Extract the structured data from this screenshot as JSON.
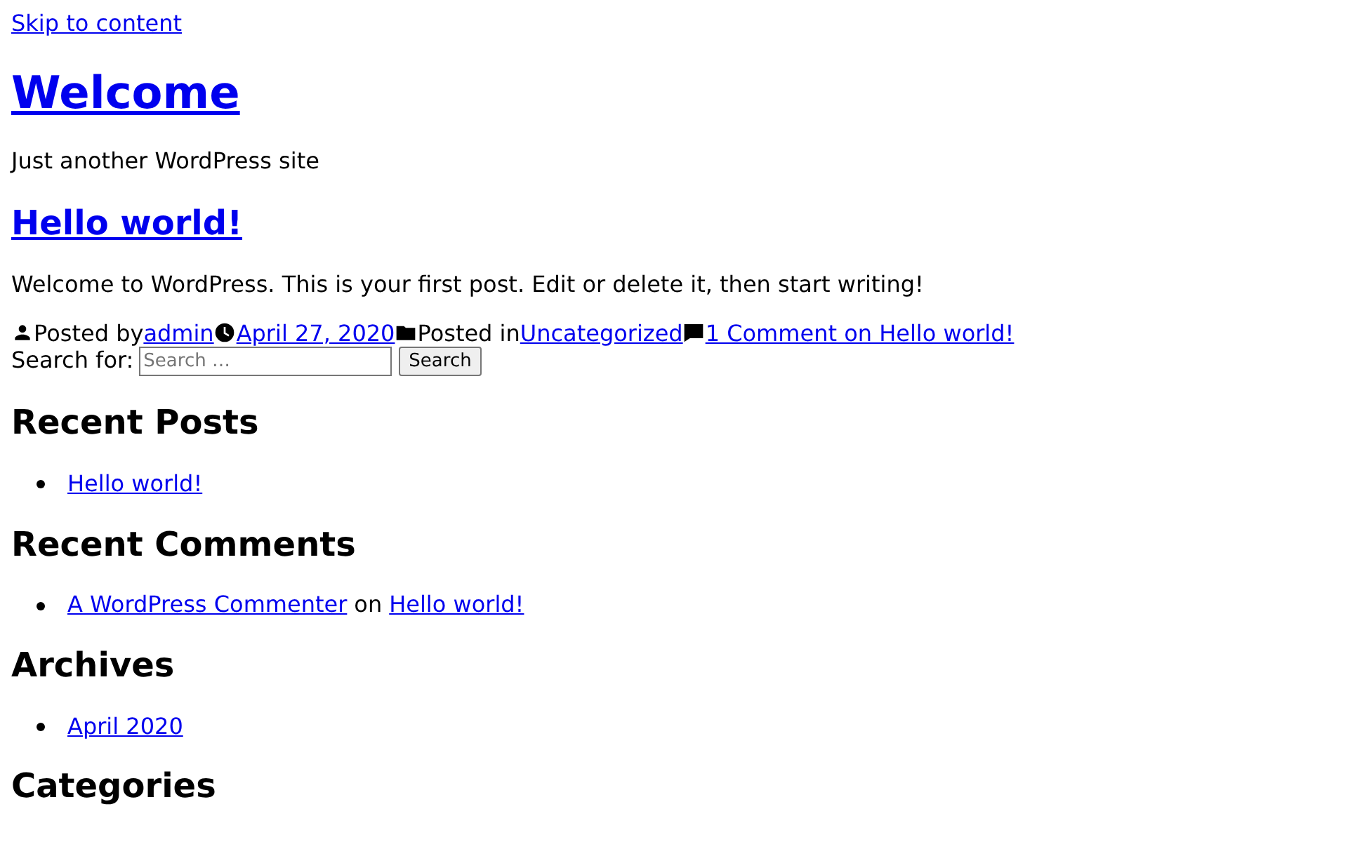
{
  "skip_link": "Skip to content",
  "site": {
    "title": "Welcome",
    "tagline": "Just another WordPress site"
  },
  "post": {
    "title": "Hello world!",
    "excerpt": "Welcome to WordPress. This is your first post. Edit or delete it, then start writing!",
    "meta": {
      "author_label": "Posted by",
      "author": "admin",
      "date": "April 27, 2020",
      "category_label": "Posted in",
      "category": "Uncategorized",
      "comments": "1 Comment on Hello world!"
    }
  },
  "search": {
    "label": "Search for:",
    "placeholder": "Search …",
    "button": "Search"
  },
  "widgets": [
    {
      "title": "Recent Posts",
      "items": [
        {
          "parts": [
            {
              "kind": "link",
              "text": "Hello world!"
            }
          ]
        }
      ]
    },
    {
      "title": "Recent Comments",
      "items": [
        {
          "parts": [
            {
              "kind": "link",
              "text": "A WordPress Commenter"
            },
            {
              "kind": "text",
              "text": "on"
            },
            {
              "kind": "link",
              "text": "Hello world!"
            }
          ]
        }
      ]
    },
    {
      "title": "Archives",
      "items": [
        {
          "parts": [
            {
              "kind": "link",
              "text": "April 2020"
            }
          ]
        }
      ]
    },
    {
      "title": "Categories"
    }
  ]
}
